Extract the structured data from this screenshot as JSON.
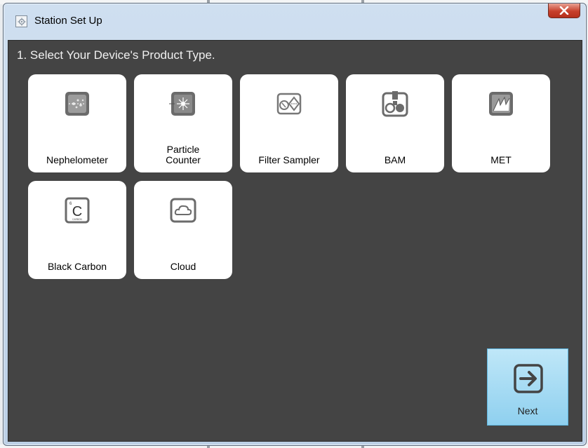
{
  "window": {
    "title": "Station Set Up",
    "instruction": "1. Select Your Device's Product Type."
  },
  "tiles": [
    {
      "label": "Nephelometer",
      "icon": "nephelometer-icon"
    },
    {
      "label": "Particle\nCounter",
      "icon": "particle-counter-icon"
    },
    {
      "label": "Filter Sampler",
      "icon": "filter-sampler-icon"
    },
    {
      "label": "BAM",
      "icon": "bam-icon"
    },
    {
      "label": "MET",
      "icon": "met-icon"
    },
    {
      "label": "Black Carbon",
      "icon": "black-carbon-icon"
    },
    {
      "label": "Cloud",
      "icon": "cloud-icon"
    }
  ],
  "black_carbon_icon_text": {
    "number": "6",
    "symbol": "C",
    "name": "CARBON"
  },
  "next_button": {
    "label": "Next",
    "icon": "arrow-right-icon"
  },
  "colors": {
    "client_bg": "#444444",
    "tile_bg": "#ffffff",
    "next_bg": "#a8dcf4",
    "close_red": "#c7402b"
  }
}
